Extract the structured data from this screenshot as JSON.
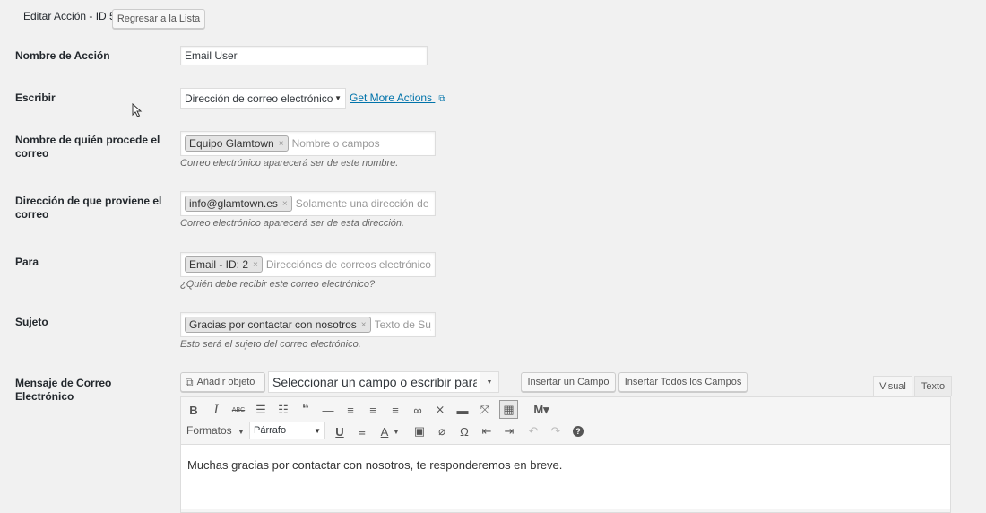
{
  "header": {
    "title": "Editar Acción - ID 5",
    "back_button": "Regresar a la Lista"
  },
  "fields": {
    "nombre": {
      "label": "Nombre de Acción",
      "value": "Email User"
    },
    "escribir": {
      "label": "Escribir",
      "selected": "Dirección de correo electrónico",
      "link": "Get More Actions"
    },
    "from_name": {
      "label": "Nombre de quién procede el correo",
      "tag": "Equipo Glamtown",
      "placeholder": "Nombre o campos",
      "description": "Correo electrónico aparecerá ser de este nombre."
    },
    "from_address": {
      "label": "Dirección de que proviene el correo",
      "tag": "info@glamtown.es",
      "placeholder": "Solamente una dirección de correo",
      "description": "Correo electrónico aparecerá ser de esta dirección."
    },
    "para": {
      "label": "Para",
      "tag": "Email - ID: 2",
      "placeholder": "Direcciónes de correos electrónicos o",
      "description": "¿Quién debe recibir este correo electrónico?"
    },
    "sujeto": {
      "label": "Sujeto",
      "tag": "Gracias por contactar con nosotros",
      "placeholder": "Texto de Sujeto",
      "description": "Esto será el sujeto del correo electrónico."
    },
    "mensaje": {
      "label": "Mensaje de Correo Electrónico",
      "add_media": "Añadir objeto",
      "field_select": "Seleccionar un campo o escribir para buscar",
      "insert_field": "Insertar un Campo",
      "insert_all": "Insertar Todos los Campos",
      "tab_visual": "Visual",
      "tab_text": "Texto",
      "formats": "Formatos",
      "paragraph": "Párrafo",
      "body": "Muchas gracias por contactar con nosotros, te responderemos en breve."
    }
  },
  "colors": {
    "link": "#0073aa",
    "background": "#f1f1f1"
  }
}
